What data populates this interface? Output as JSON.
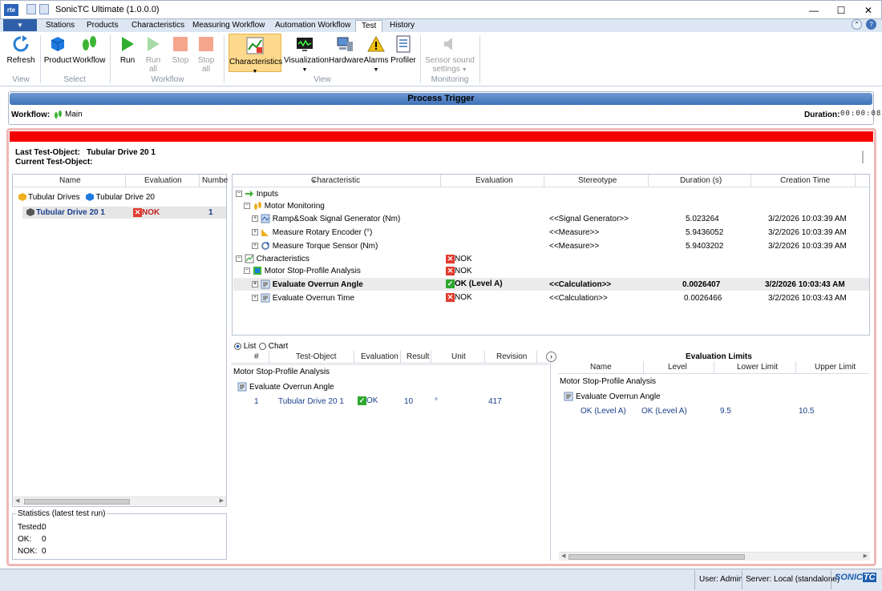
{
  "app": {
    "title": "SonicTC Ultimate (1.0.0.0)",
    "logo_text": "rte"
  },
  "window": {
    "minimize": "—",
    "maximize": "☐",
    "close": "✕"
  },
  "menu": {
    "tabs": [
      "Stations",
      "Products",
      "Characteristics",
      "Measuring Workflow",
      "Automation Workflow",
      "Test",
      "History"
    ],
    "active": "Test"
  },
  "ribbon": {
    "refresh": "Refresh",
    "product": "Product",
    "workflow": "Workflow",
    "run": "Run",
    "run_all_1": "Run",
    "run_all_2": "all",
    "stop": "Stop",
    "stop_all_1": "Stop",
    "stop_all_2": "all",
    "characteristics": "Characteristics",
    "visualization": "Visualization",
    "hardware": "Hardware",
    "alarms": "Alarms",
    "profiler": "Profiler",
    "sensor_1": "Sensor sound",
    "sensor_2": "settings",
    "groups": {
      "view": "View",
      "select": "Select",
      "workflow": "Workflow",
      "view2": "View",
      "monitoring": "Monitoring"
    }
  },
  "process_trigger": {
    "title": "Process Trigger",
    "workflow_label": "Workflow:",
    "workflow_value": "Main",
    "duration_label": "Duration:",
    "duration_value": "00:00:08"
  },
  "test_object": {
    "last_label": "Last Test-Object:",
    "last_value": "Tubular Drive 20 1",
    "current_label": "Current Test-Object:"
  },
  "left_table": {
    "headers": [
      "Name",
      "Evaluation",
      "Numbe"
    ],
    "group": {
      "a": "Tubular Drives",
      "b": "Tubular Drive 20"
    },
    "row": {
      "name": "Tubular Drive 20 1",
      "eval": "NOK",
      "num": "1"
    }
  },
  "stats": {
    "title": "Statistics (latest test run)",
    "tested": "Tested:",
    "tested_v": "0",
    "ok": "OK:",
    "ok_v": "0",
    "nok": "NOK:",
    "nok_v": "0"
  },
  "char_table": {
    "headers": [
      "Characteristic",
      "Evaluation",
      "Stereotype",
      "Duration (s)",
      "Creation Time"
    ],
    "rows": [
      {
        "label": "Inputs"
      },
      {
        "label": "Motor Monitoring"
      },
      {
        "label": "Ramp&Soak Signal Generator (Nm)",
        "stereo": "<<Signal Generator>>",
        "dur": "5.023264",
        "time": "3/2/2026 10:03:39 AM"
      },
      {
        "label": "Measure Rotary Encoder (°)",
        "stereo": "<<Measure>>",
        "dur": "5.9436052",
        "time": "3/2/2026 10:03:39 AM"
      },
      {
        "label": "Measure Torque Sensor (Nm)",
        "stereo": "<<Measure>>",
        "dur": "5.9403202",
        "time": "3/2/2026 10:03:39 AM"
      },
      {
        "label": "Characteristics",
        "eval": "NOK"
      },
      {
        "label": "Motor Stop-Profile Analysis",
        "eval": "NOK"
      },
      {
        "label": "Evaluate Overrun Angle",
        "eval": "OK (Level A)",
        "stereo": "<<Calculation>>",
        "dur": "0.0026407",
        "time": "3/2/2026 10:03:43 AM"
      },
      {
        "label": "Evaluate Overrun Time",
        "eval": "NOK",
        "stereo": "<<Calculation>>",
        "dur": "0.0026466",
        "time": "3/2/2026 10:03:43 AM"
      }
    ]
  },
  "view_mode": {
    "list": "List",
    "chart": "Chart"
  },
  "results": {
    "headers": [
      "#",
      "Test-Object",
      "Evaluation",
      "Result",
      "Unit",
      "Revision"
    ],
    "group": "Motor Stop-Profile Analysis",
    "sub": "Evaluate Overrun Angle",
    "row": {
      "num": "1",
      "obj": "Tubular Drive 20 1",
      "eval": "OK",
      "result": "10",
      "unit": "°",
      "rev": "417"
    }
  },
  "limits": {
    "title": "Evaluation Limits",
    "headers": [
      "Name",
      "Level",
      "Lower Limit",
      "Upper Limit"
    ],
    "group": "Motor Stop-Profile Analysis",
    "sub": "Evaluate Overrun Angle",
    "row": {
      "name": "OK (Level A)",
      "level": "OK (Level A)",
      "lower": "9.5",
      "upper": "10.5"
    }
  },
  "status": {
    "user": "User: Admin",
    "server": "Server: Local (standalone)",
    "brand_a": "SONIC",
    "brand_b": "TC"
  },
  "colors": {
    "accent": "#3f72b9",
    "alarm": "#f50000",
    "ok": "#2ea82e",
    "nok": "#e23b2e"
  }
}
